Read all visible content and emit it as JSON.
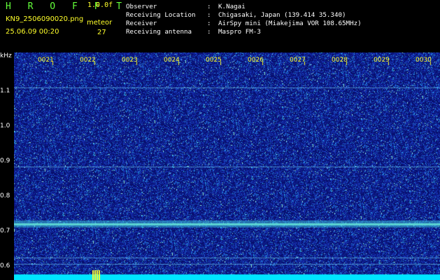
{
  "header": {
    "logo": "H R O F F T",
    "version": "1.0.0f",
    "filename": "KN9_2506090020.png",
    "datetime": "25.06.09 00:20",
    "meteor_label": "meteor",
    "meteor_count": "27",
    "info": [
      {
        "key": "Observer",
        "sep": ":",
        "value": "K.Nagai"
      },
      {
        "key": "Receiving Location",
        "sep": ":",
        "value": "Chigasaki, Japan (139.414 35.340)"
      },
      {
        "key": "Receiver",
        "sep": ":",
        "value": "AirSpy mini (Miakejima VOR 108.65MHz)"
      },
      {
        "key": "Receiving antenna",
        "sep": ":",
        "value": "Maspro FM-3"
      }
    ]
  },
  "axis": {
    "unit": "kHz",
    "y_ticks": [
      "1.1",
      "1.0",
      "0.9",
      "0.8",
      "0.7",
      "0.6"
    ],
    "x_ticks": [
      "0021",
      "0022",
      "0023",
      "0024",
      "0025",
      "0026",
      "0027",
      "0028",
      "0029",
      "0030"
    ]
  },
  "colors": {
    "background": "#000000",
    "noise": "#1a2aa0",
    "carrier": "#7fffd0",
    "baseline": "#00e5ff"
  }
}
